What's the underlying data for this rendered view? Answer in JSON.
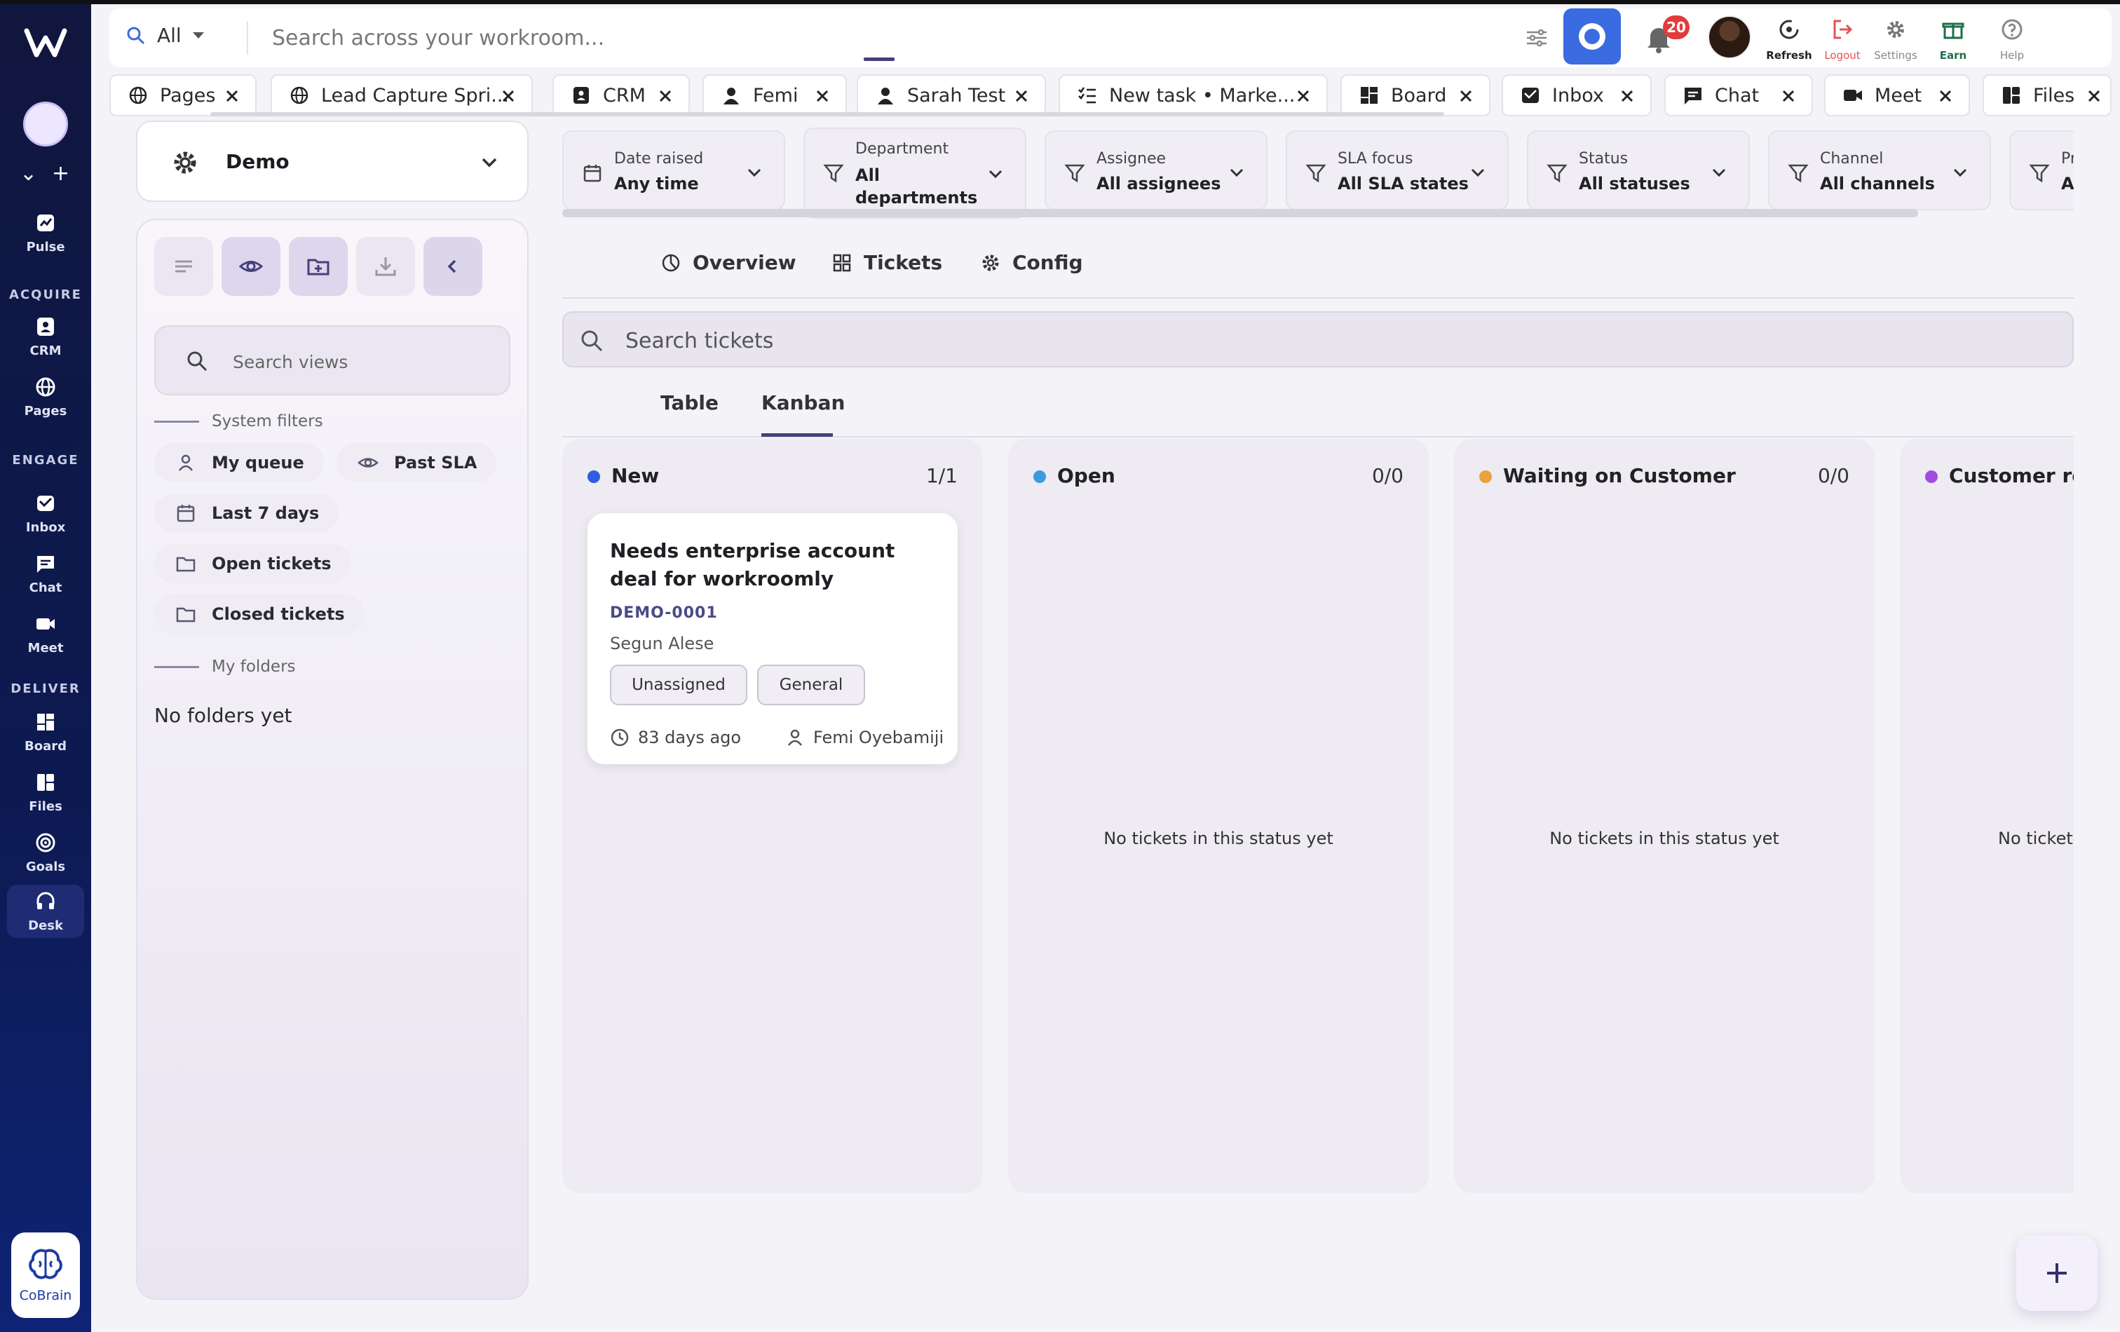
{
  "rail": {
    "sections": {
      "acquire": "ACQUIRE",
      "engage": "ENGAGE",
      "deliver": "DELIVER"
    },
    "items": [
      {
        "key": "pulse",
        "label": "Pulse",
        "icon": "pulse-icon"
      },
      {
        "key": "crm",
        "label": "CRM",
        "icon": "crm-icon"
      },
      {
        "key": "pages",
        "label": "Pages",
        "icon": "globe-icon"
      },
      {
        "key": "inbox",
        "label": "Inbox",
        "icon": "inbox-icon"
      },
      {
        "key": "chat",
        "label": "Chat",
        "icon": "chat-icon"
      },
      {
        "key": "meet",
        "label": "Meet",
        "icon": "video-icon"
      },
      {
        "key": "board",
        "label": "Board",
        "icon": "board-icon"
      },
      {
        "key": "files",
        "label": "Files",
        "icon": "files-icon"
      },
      {
        "key": "goals",
        "label": "Goals",
        "icon": "target-icon"
      },
      {
        "key": "desk",
        "label": "Desk",
        "icon": "headset-icon",
        "active": true
      }
    ],
    "cobrain_label": "CoBrain"
  },
  "topbar": {
    "scope": "All",
    "search_placeholder": "Search across your workroom...",
    "notifications_count": "20",
    "tools": {
      "refresh": "Refresh",
      "logout": "Logout",
      "settings": "Settings",
      "earn": "Earn",
      "help": "Help"
    }
  },
  "open_tabs": [
    {
      "label": "Pages",
      "icon": "globe-icon"
    },
    {
      "label": "Lead Capture Spri...",
      "icon": "globe-icon"
    },
    {
      "label": "CRM",
      "icon": "crm-icon"
    },
    {
      "label": "Femi",
      "icon": "person-icon"
    },
    {
      "label": "Sarah Test",
      "icon": "person-icon"
    },
    {
      "label": "New task • Marke...",
      "icon": "checklist-icon"
    },
    {
      "label": "Board",
      "icon": "board-icon"
    },
    {
      "label": "Inbox",
      "icon": "inbox-icon"
    },
    {
      "label": "Chat",
      "icon": "chat-icon"
    },
    {
      "label": "Meet",
      "icon": "video-icon"
    },
    {
      "label": "Files",
      "icon": "files-icon"
    }
  ],
  "workspace": {
    "name": "Demo"
  },
  "views": {
    "search_placeholder": "Search views",
    "system_filters_heading": "System filters",
    "system_filters": [
      "My queue",
      "Past SLA",
      "Last 7 days",
      "Open tickets",
      "Closed tickets"
    ],
    "my_folders_heading": "My folders",
    "no_folders": "No folders yet"
  },
  "filters": [
    {
      "key": "Date raised",
      "value": "Any time",
      "icon": "calendar-icon"
    },
    {
      "key": "Department",
      "value": "All departments",
      "icon": "funnel-icon"
    },
    {
      "key": "Assignee",
      "value": "All assignees",
      "icon": "funnel-icon"
    },
    {
      "key": "SLA focus",
      "value": "All SLA states",
      "icon": "funnel-icon"
    },
    {
      "key": "Status",
      "value": "All statuses",
      "icon": "funnel-icon"
    },
    {
      "key": "Channel",
      "value": "All channels",
      "icon": "funnel-icon"
    },
    {
      "key": "Pr",
      "value": "Ar",
      "icon": "funnel-icon"
    }
  ],
  "main_tabs": [
    "Overview",
    "Tickets",
    "Config"
  ],
  "active_main_tab": "Tickets",
  "ticket_search_placeholder": "Search tickets",
  "view_tabs": [
    "Table",
    "Kanban"
  ],
  "active_view_tab": "Kanban",
  "columns": [
    {
      "title": "New",
      "count": "1/1",
      "color": "#2f5fe0",
      "cards": [
        {
          "title": "Needs enterprise account deal for workroomly",
          "id": "DEMO-0001",
          "requester": "Segun Alese",
          "tags": [
            "Unassigned",
            "General"
          ],
          "age": "83 days ago",
          "owner": "Femi Oyebamiji"
        }
      ]
    },
    {
      "title": "Open",
      "count": "0/0",
      "color": "#3a9be0",
      "empty": "No tickets in this status yet"
    },
    {
      "title": "Waiting on Customer",
      "count": "0/0",
      "color": "#e8a33a",
      "empty": "No tickets in this status yet"
    },
    {
      "title": "Customer res",
      "count": "",
      "color": "#a14be0",
      "empty": "No tickets"
    }
  ]
}
